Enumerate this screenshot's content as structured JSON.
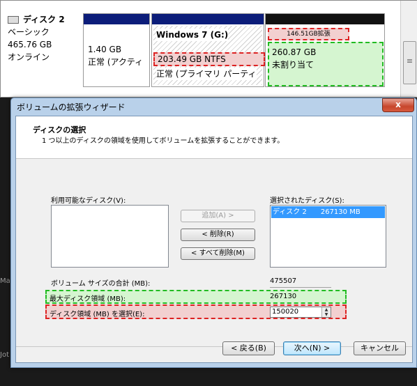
{
  "disk": {
    "name": "ディスク 2",
    "type": "ベーシック",
    "size": "465.76 GB",
    "status": "オンライン"
  },
  "partitions": [
    {
      "size": "1.40 GB",
      "status": "正常 (アクティ"
    },
    {
      "name": "Windows 7  (G:)",
      "size": "203.49 GB NTFS",
      "status": "正常 (プライマリ パーティ"
    },
    {
      "extend_label": "146.51GB拡張",
      "size": "260.87 GB",
      "status": "未割り当て"
    }
  ],
  "wizard": {
    "title": "ボリュームの拡張ウィザード",
    "close_glyph": "x",
    "header_title": "ディスクの選択",
    "header_desc": "1 つ以上のディスクの領域を使用してボリュームを拡張することができます。",
    "available_label": "利用可能なディスク(V):",
    "selected_label": "選択されたディスク(S):",
    "selected_items": [
      {
        "disk": "ディスク 2",
        "mb": "267130 MB"
      }
    ],
    "add_button": "追加(A) >",
    "remove_button": "< 削除(R)",
    "remove_all_button": "< すべて削除(M)",
    "total_label": "ボリューム サイズの合計 (MB):",
    "total_value": "475507",
    "max_label": "最大ディスク領域 (MB):",
    "max_value": "267130",
    "select_label": "ディスク領域 (MB) を選択(E):",
    "select_value": "150020",
    "back_button": "< 戻る(B)",
    "next_button": "次へ(N) >",
    "cancel_button": "キャンセル"
  },
  "desktop": {
    "left_text_1": "Mac",
    "left_text_2": "Jot"
  },
  "colors": {
    "partition_bar": "#0c1d7a",
    "highlight_green": "#22bb22",
    "highlight_red": "#dd2222",
    "selection": "#3399ff"
  }
}
